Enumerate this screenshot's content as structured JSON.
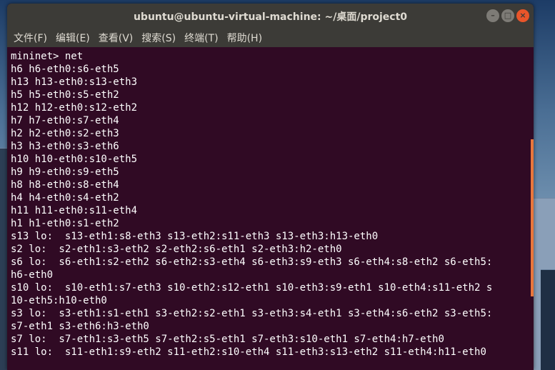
{
  "window": {
    "title": "ubuntu@ubuntu-virtual-machine: ~/桌面/project0",
    "buttons": {
      "minimize": "–",
      "maximize": "□",
      "close": "×"
    }
  },
  "menubar": {
    "items": [
      "文件(F)",
      "编辑(E)",
      "查看(V)",
      "搜索(S)",
      "终端(T)",
      "帮助(H)"
    ]
  },
  "terminal": {
    "lines": [
      "mininet> net",
      "h6 h6-eth0:s6-eth5",
      "h13 h13-eth0:s13-eth3",
      "h5 h5-eth0:s5-eth2",
      "h12 h12-eth0:s12-eth2",
      "h7 h7-eth0:s7-eth4",
      "h2 h2-eth0:s2-eth3",
      "h3 h3-eth0:s3-eth6",
      "h10 h10-eth0:s10-eth5",
      "h9 h9-eth0:s9-eth5",
      "h8 h8-eth0:s8-eth4",
      "h4 h4-eth0:s4-eth2",
      "h11 h11-eth0:s11-eth4",
      "h1 h1-eth0:s1-eth2",
      "s13 lo:  s13-eth1:s8-eth3 s13-eth2:s11-eth3 s13-eth3:h13-eth0",
      "s2 lo:  s2-eth1:s3-eth2 s2-eth2:s6-eth1 s2-eth3:h2-eth0",
      "s6 lo:  s6-eth1:s2-eth2 s6-eth2:s3-eth4 s6-eth3:s9-eth3 s6-eth4:s8-eth2 s6-eth5:",
      "h6-eth0",
      "s10 lo:  s10-eth1:s7-eth3 s10-eth2:s12-eth1 s10-eth3:s9-eth1 s10-eth4:s11-eth2 s",
      "10-eth5:h10-eth0",
      "s3 lo:  s3-eth1:s1-eth1 s3-eth2:s2-eth1 s3-eth3:s4-eth1 s3-eth4:s6-eth2 s3-eth5:",
      "s7-eth1 s3-eth6:h3-eth0",
      "s7 lo:  s7-eth1:s3-eth5 s7-eth2:s5-eth1 s7-eth3:s10-eth1 s7-eth4:h7-eth0",
      "s11 lo:  s11-eth1:s9-eth2 s11-eth2:s10-eth4 s11-eth3:s13-eth2 s11-eth4:h11-eth0"
    ]
  },
  "colors": {
    "terminal_bg": "#300a24",
    "titlebar_bg": "#3c3b37",
    "close_button": "#e9552a",
    "scrollbar": "#e9763c"
  }
}
